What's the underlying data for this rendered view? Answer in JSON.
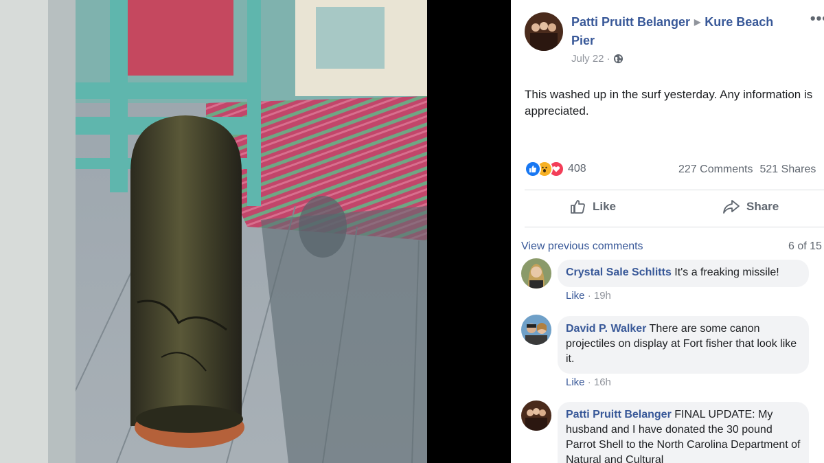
{
  "post": {
    "author": "Patti Pruitt Belanger",
    "location": "Kure Beach Pier",
    "date": "July 22",
    "text": "This washed up in the surf yesterday. Any information is appreciated.",
    "reaction_count": "408",
    "comments_count": "227 Comments",
    "shares_count": "521 Shares",
    "reaction_icons": [
      "like-reaction",
      "wow-reaction",
      "love-reaction"
    ],
    "colors": {
      "link_blue": "#385898",
      "like_blue": "#1877f2",
      "love_red": "#f33e58",
      "wow_yellow": "#f7b125"
    }
  },
  "actions": {
    "like_label": "Like",
    "share_label": "Share"
  },
  "comments_section": {
    "view_previous": "View previous comments",
    "count": "6 of 15"
  },
  "comments": [
    {
      "name": "Crystal Sale Schlitts",
      "text": "It's a freaking missile!",
      "like_label": "Like",
      "time": "19h"
    },
    {
      "name": "David P. Walker",
      "text": "There are some canon projectiles on display at Fort fisher that look like it.",
      "like_label": "Like",
      "time": "16h"
    },
    {
      "name": "Patti Pruitt Belanger",
      "text": "FINAL UPDATE: My husband and I have donated the 30 pound Parrot Shell to the North Carolina Department of Natural and Cultural"
    }
  ]
}
